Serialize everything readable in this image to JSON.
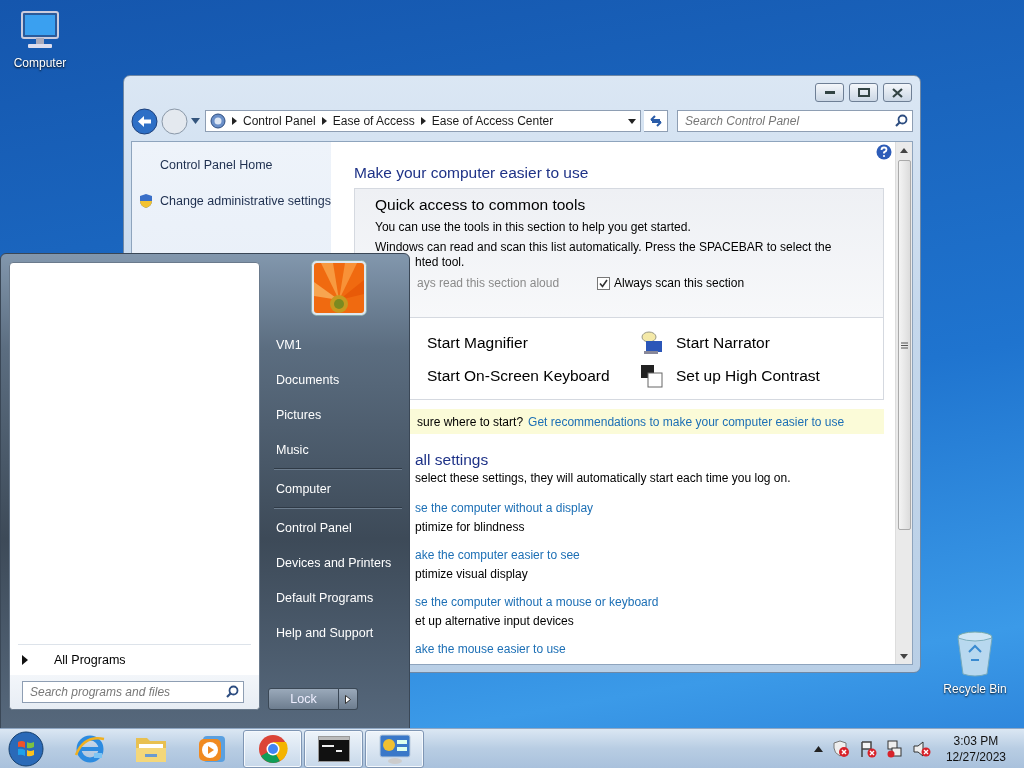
{
  "desktop_icons": [
    {
      "label": "Computer",
      "kind": "computer"
    },
    {
      "label": "Recycle Bin",
      "kind": "recycle"
    }
  ],
  "window": {
    "breadcrumb": [
      "Control Panel",
      "Ease of Access",
      "Ease of Access Center"
    ],
    "search": {
      "placeholder": "Search Control Panel"
    },
    "sidebar": {
      "items": [
        {
          "label": "Control Panel Home",
          "kind": "plain"
        },
        {
          "label": "Change administrative settings",
          "kind": "shield"
        }
      ]
    },
    "content": {
      "title": "Make your computer easier to use",
      "quick_access": {
        "heading": "Quick access to common tools",
        "lines": [
          "You can use the tools in this section to help you get started.",
          "Windows can read and scan this list automatically.  Press the SPACEBAR to select the"
        ],
        "line_fragment": "hted tool.",
        "options": [
          {
            "label": "ays read this section aloud",
            "disabled": true
          },
          {
            "label": "Always scan this section",
            "disabled": false,
            "checked": true
          }
        ],
        "tools": [
          {
            "label": "Start Magnifier",
            "kind": "covered"
          },
          {
            "label": "Start Narrator",
            "kind": "narrator"
          },
          {
            "label": "Start On-Screen Keyboard",
            "kind": "covered"
          },
          {
            "label": "Set up High Contrast",
            "kind": "contrast"
          }
        ]
      },
      "hint": {
        "text": "sure where to start?",
        "link": "Get recommendations to make your computer easier to use"
      },
      "settings": {
        "heading": "all settings",
        "intro": "select these settings, they will automatically start each time you log on.",
        "items": [
          {
            "link": "se the computer without a display",
            "description": "ptimize for blindness"
          },
          {
            "link": "ake the computer easier to see",
            "description": "ptimize visual display"
          },
          {
            "link": "se the computer without a mouse or keyboard",
            "description": "et up alternative input devices"
          },
          {
            "link": "ake the mouse easier to use"
          }
        ]
      }
    }
  },
  "start_menu": {
    "all_programs": "All Programs",
    "search": {
      "placeholder": "Search programs and files"
    },
    "places": [
      {
        "label": "VM1",
        "group_start": false
      },
      {
        "label": "Documents",
        "group_start": false
      },
      {
        "label": "Pictures",
        "group_start": false
      },
      {
        "label": "Music",
        "group_start": false
      },
      {
        "label": "Computer",
        "group_start": true
      },
      {
        "label": "Control Panel",
        "group_start": true
      },
      {
        "label": "Devices and Printers",
        "group_start": false
      },
      {
        "label": "Default Programs",
        "group_start": false
      },
      {
        "label": "Help and Support",
        "group_start": false
      }
    ],
    "power_button": "Lock"
  },
  "taskbar": {
    "apps": [
      {
        "kind": "browser-e",
        "running": false
      },
      {
        "kind": "folder",
        "running": false
      },
      {
        "kind": "media",
        "running": false
      },
      {
        "kind": "chrome",
        "running": true
      },
      {
        "kind": "terminal",
        "running": true
      },
      {
        "kind": "panel",
        "running": true
      }
    ],
    "clock": {
      "time": "3:03 PM",
      "date": "12/27/2023"
    }
  }
}
